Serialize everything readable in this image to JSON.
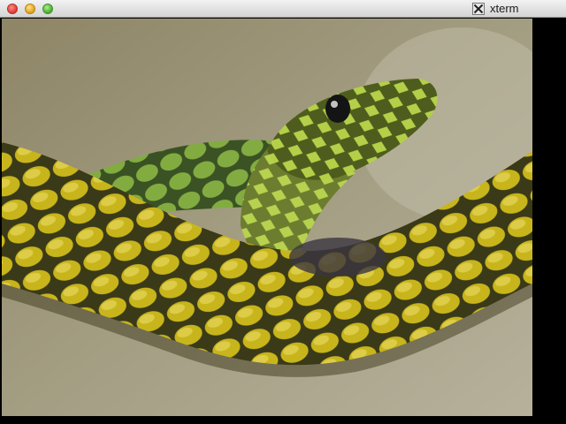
{
  "window": {
    "title": "xterm",
    "app_icon": "x11-icon",
    "controls": [
      "close-icon",
      "minimize-icon",
      "zoom-icon"
    ]
  },
  "content": {
    "image_subject": "snake-photo",
    "colors": {
      "background": "#8f8a70",
      "snake_scales": "#c9b41e",
      "snake_head": "#a6c83b"
    }
  }
}
